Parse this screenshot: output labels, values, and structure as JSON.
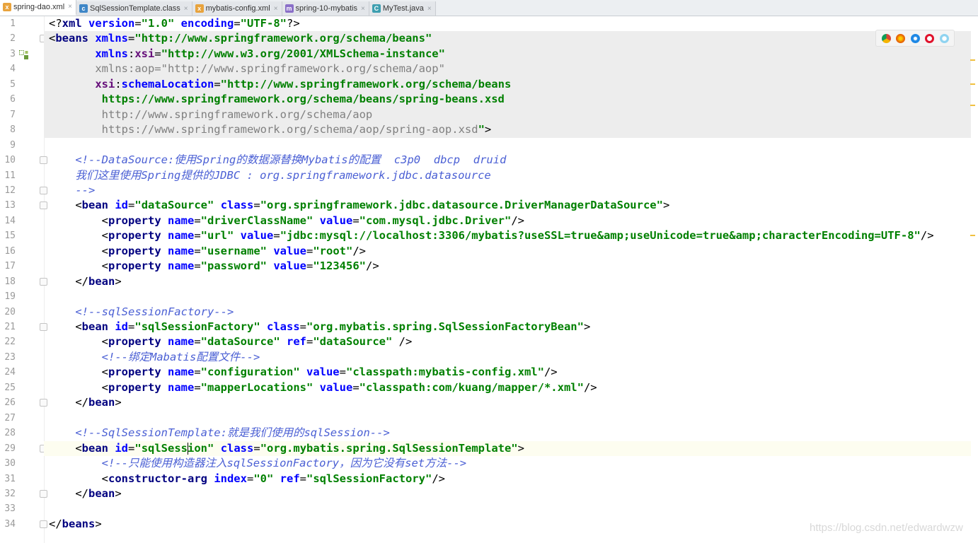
{
  "tabs": [
    {
      "label": "spring-dao.xml",
      "icon": "xml-file-icon",
      "active": true
    },
    {
      "label": "SqlSessionTemplate.class",
      "icon": "class-file-icon",
      "active": false
    },
    {
      "label": "mybatis-config.xml",
      "icon": "xml-file-icon",
      "active": false
    },
    {
      "label": "spring-10-mybatis",
      "icon": "module-icon",
      "active": false
    },
    {
      "label": "MyTest.java",
      "icon": "java-class-icon",
      "active": false
    }
  ],
  "tab_close_glyph": "×",
  "line_numbers": [
    "1",
    "2",
    "3",
    "4",
    "5",
    "6",
    "7",
    "8",
    "9",
    "10",
    "11",
    "12",
    "13",
    "14",
    "15",
    "16",
    "17",
    "18",
    "19",
    "20",
    "21",
    "22",
    "23",
    "24",
    "25",
    "26",
    "27",
    "28",
    "29",
    "30",
    "31",
    "32",
    "33",
    "34"
  ],
  "code_lines": [
    [
      [
        "pl",
        "<?"
      ],
      [
        "tg",
        "xml "
      ],
      [
        "an",
        "version"
      ],
      [
        "pl",
        "="
      ],
      [
        "av",
        "\"1.0\" "
      ],
      [
        "an",
        "encoding"
      ],
      [
        "pl",
        "="
      ],
      [
        "av",
        "\"UTF-8\""
      ],
      [
        "pl",
        "?>"
      ]
    ],
    [
      [
        "pl",
        "<"
      ],
      [
        "tg",
        "beans "
      ],
      [
        "an",
        "xmlns"
      ],
      [
        "pl",
        "="
      ],
      [
        "av",
        "\"http://www.springframework.org/schema/beans\""
      ]
    ],
    [
      [
        "pl",
        "       "
      ],
      [
        "an",
        "xmlns"
      ],
      [
        "pl",
        ":"
      ],
      [
        "nsk",
        "xsi"
      ],
      [
        "pl",
        "="
      ],
      [
        "av",
        "\"http://www.w3.org/2001/XMLSchema-instance\""
      ]
    ],
    [
      [
        "gy",
        "       xmlns:aop=\"http://www.springframework.org/schema/aop\""
      ]
    ],
    [
      [
        "pl",
        "       "
      ],
      [
        "nsk",
        "xsi"
      ],
      [
        "pl",
        ":"
      ],
      [
        "an",
        "schemaLocation"
      ],
      [
        "pl",
        "="
      ],
      [
        "av",
        "\"http://www.springframework.org/schema/beans"
      ]
    ],
    [
      [
        "av",
        "        https://www.springframework.org/schema/beans/spring-beans.xsd"
      ]
    ],
    [
      [
        "gy",
        "        http://www.springframework.org/schema/aop"
      ]
    ],
    [
      [
        "gy",
        "        https://www.springframework.org/schema/aop/spring-aop.xsd"
      ],
      [
        "av",
        "\""
      ],
      [
        "pl",
        ">"
      ]
    ],
    [],
    [
      [
        "cm",
        "    <!--DataSource:使用Spring的数据源替换Mybatis的配置  c3p0  dbcp  druid"
      ]
    ],
    [
      [
        "cm",
        "    我们这里使用Spring提供的JDBC : org.springframework.jdbc.datasource"
      ]
    ],
    [
      [
        "cm",
        "    -->"
      ]
    ],
    [
      [
        "pl",
        "    <"
      ],
      [
        "tg",
        "bean "
      ],
      [
        "an",
        "id"
      ],
      [
        "pl",
        "="
      ],
      [
        "av",
        "\"dataSource\" "
      ],
      [
        "an",
        "class"
      ],
      [
        "pl",
        "="
      ],
      [
        "av",
        "\"org.springframework.jdbc.datasource.DriverManagerDataSource\""
      ],
      [
        "pl",
        ">"
      ]
    ],
    [
      [
        "pl",
        "        <"
      ],
      [
        "tg",
        "property "
      ],
      [
        "an",
        "name"
      ],
      [
        "pl",
        "="
      ],
      [
        "av",
        "\"driverClassName\" "
      ],
      [
        "an",
        "value"
      ],
      [
        "pl",
        "="
      ],
      [
        "av",
        "\"com.mysql.jdbc.Driver\""
      ],
      [
        "pl",
        "/>"
      ]
    ],
    [
      [
        "pl",
        "        <"
      ],
      [
        "tg",
        "property "
      ],
      [
        "an",
        "name"
      ],
      [
        "pl",
        "="
      ],
      [
        "av",
        "\"url\" "
      ],
      [
        "an",
        "value"
      ],
      [
        "pl",
        "="
      ],
      [
        "av",
        "\"jdbc:mysql://localhost:3306/mybatis?useSSL=true&amp;useUnicode=true&amp;characterEncoding=UTF-8\""
      ],
      [
        "pl",
        "/>"
      ]
    ],
    [
      [
        "pl",
        "        <"
      ],
      [
        "tg",
        "property "
      ],
      [
        "an",
        "name"
      ],
      [
        "pl",
        "="
      ],
      [
        "av",
        "\"username\" "
      ],
      [
        "an",
        "value"
      ],
      [
        "pl",
        "="
      ],
      [
        "av",
        "\"root\""
      ],
      [
        "pl",
        "/>"
      ]
    ],
    [
      [
        "pl",
        "        <"
      ],
      [
        "tg",
        "property "
      ],
      [
        "an",
        "name"
      ],
      [
        "pl",
        "="
      ],
      [
        "av",
        "\"password\" "
      ],
      [
        "an",
        "value"
      ],
      [
        "pl",
        "="
      ],
      [
        "av",
        "\"123456\""
      ],
      [
        "pl",
        "/>"
      ]
    ],
    [
      [
        "pl",
        "    </"
      ],
      [
        "tg",
        "bean"
      ],
      [
        "pl",
        ">"
      ]
    ],
    [],
    [
      [
        "cm",
        "    <!--sqlSessionFactory-->"
      ]
    ],
    [
      [
        "pl",
        "    <"
      ],
      [
        "tg",
        "bean "
      ],
      [
        "an",
        "id"
      ],
      [
        "pl",
        "="
      ],
      [
        "av",
        "\"sqlSessionFactory\" "
      ],
      [
        "an",
        "class"
      ],
      [
        "pl",
        "="
      ],
      [
        "av",
        "\"org.mybatis.spring.SqlSessionFactoryBean\""
      ],
      [
        "pl",
        ">"
      ]
    ],
    [
      [
        "pl",
        "        <"
      ],
      [
        "tg",
        "property "
      ],
      [
        "an",
        "name"
      ],
      [
        "pl",
        "="
      ],
      [
        "av",
        "\"dataSource\" "
      ],
      [
        "an",
        "ref"
      ],
      [
        "pl",
        "="
      ],
      [
        "av",
        "\"dataSource\" "
      ],
      [
        "pl",
        "/>"
      ]
    ],
    [
      [
        "cm",
        "        <!--绑定Mabatis配置文件-->"
      ]
    ],
    [
      [
        "pl",
        "        <"
      ],
      [
        "tg",
        "property "
      ],
      [
        "an",
        "name"
      ],
      [
        "pl",
        "="
      ],
      [
        "av",
        "\"configuration\" "
      ],
      [
        "an",
        "value"
      ],
      [
        "pl",
        "="
      ],
      [
        "av",
        "\"classpath:mybatis-config.xml\""
      ],
      [
        "pl",
        "/>"
      ]
    ],
    [
      [
        "pl",
        "        <"
      ],
      [
        "tg",
        "property "
      ],
      [
        "an",
        "name"
      ],
      [
        "pl",
        "="
      ],
      [
        "av",
        "\"mapperLocations\" "
      ],
      [
        "an",
        "value"
      ],
      [
        "pl",
        "="
      ],
      [
        "av",
        "\"classpath:com/kuang/mapper/*.xml\""
      ],
      [
        "pl",
        "/>"
      ]
    ],
    [
      [
        "pl",
        "    </"
      ],
      [
        "tg",
        "bean"
      ],
      [
        "pl",
        ">"
      ]
    ],
    [],
    [
      [
        "cm",
        "    <!--SqlSessionTemplate:就是我们使用的sqlSession-->"
      ]
    ],
    [
      [
        "pl",
        "    <"
      ],
      [
        "tg",
        "bean "
      ],
      [
        "an",
        "id"
      ],
      [
        "pl",
        "="
      ],
      [
        "av",
        "\"sqlSession\" "
      ],
      [
        "an",
        "class"
      ],
      [
        "pl",
        "="
      ],
      [
        "av",
        "\"org.mybatis.spring.SqlSessionTemplate\""
      ],
      [
        "pl",
        ">"
      ]
    ],
    [
      [
        "cm",
        "        <!--只能使用构造器注入sqlSessionFactory，因为它没有set方法-->"
      ]
    ],
    [
      [
        "pl",
        "        <"
      ],
      [
        "tg",
        "constructor-arg "
      ],
      [
        "an",
        "index"
      ],
      [
        "pl",
        "="
      ],
      [
        "av",
        "\"0\" "
      ],
      [
        "an",
        "ref"
      ],
      [
        "pl",
        "="
      ],
      [
        "av",
        "\"sqlSessionFactory\""
      ],
      [
        "pl",
        "/>"
      ]
    ],
    [
      [
        "pl",
        "    </"
      ],
      [
        "tg",
        "bean"
      ],
      [
        "pl",
        ">"
      ]
    ],
    [],
    [
      [
        "pl",
        "</"
      ],
      [
        "tg",
        "beans"
      ],
      [
        "pl",
        ">"
      ]
    ]
  ],
  "browser_icons": [
    "chrome-icon",
    "firefox-icon",
    "safari-icon",
    "opera-icon",
    "ie-icon"
  ],
  "watermark": "https://blog.csdn.net/edwardwzw"
}
